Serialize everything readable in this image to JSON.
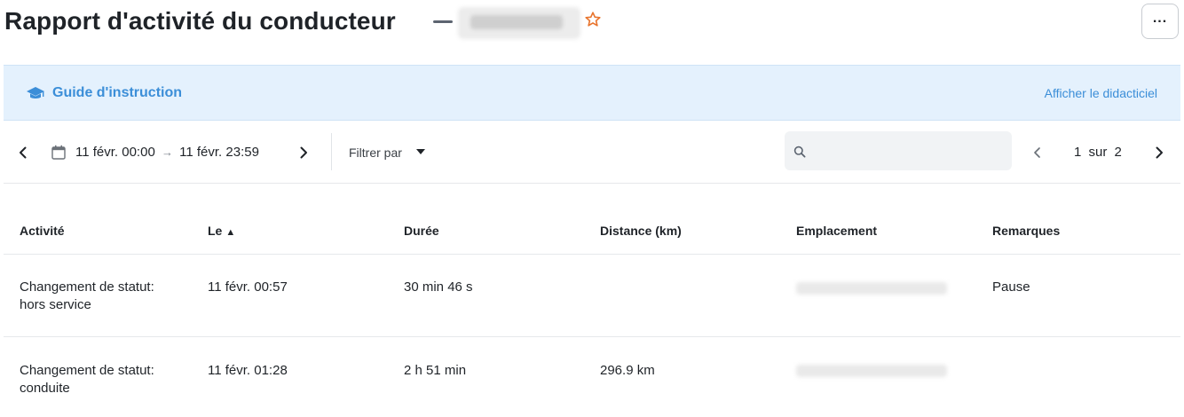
{
  "header": {
    "title": "Rapport d'activité du conducteur",
    "favorite_icon": "star-outline-icon",
    "favorite_color": "#e8742d",
    "more_label": "..."
  },
  "guide": {
    "icon": "graduation-cap-icon",
    "title": "Guide d'instruction",
    "link": "Afficher le didacticiel",
    "accent": "#3b8ed8",
    "background": "#e4f1fd"
  },
  "toolbar": {
    "date_start": "11 févr. 00:00",
    "date_arrow": "→",
    "date_end": "11 févr. 23:59",
    "filter_label": "Filtrer par",
    "search_placeholder": "",
    "search_value": "",
    "pager": {
      "current": "1",
      "of": "sur",
      "total": "2"
    }
  },
  "table": {
    "columns": [
      {
        "label": "Activité"
      },
      {
        "label": "Le",
        "sort": "▲"
      },
      {
        "label": "Durée"
      },
      {
        "label": "Distance (km)"
      },
      {
        "label": "Emplacement"
      },
      {
        "label": "Remarques"
      }
    ],
    "rows": [
      {
        "activity": "Changement de statut: hors service",
        "activity_line1": "Changement de statut:",
        "activity_line2": "hors service",
        "date": "11 févr. 00:57",
        "duration": "30 min 46 s",
        "distance": "",
        "remarks": "Pause"
      },
      {
        "activity": "Changement de statut: conduite",
        "activity_line1": "Changement de statut:",
        "activity_line2": "conduite",
        "date": "11 févr. 01:28",
        "duration": "2 h 51 min",
        "distance": "296.9 km",
        "remarks": ""
      }
    ]
  }
}
